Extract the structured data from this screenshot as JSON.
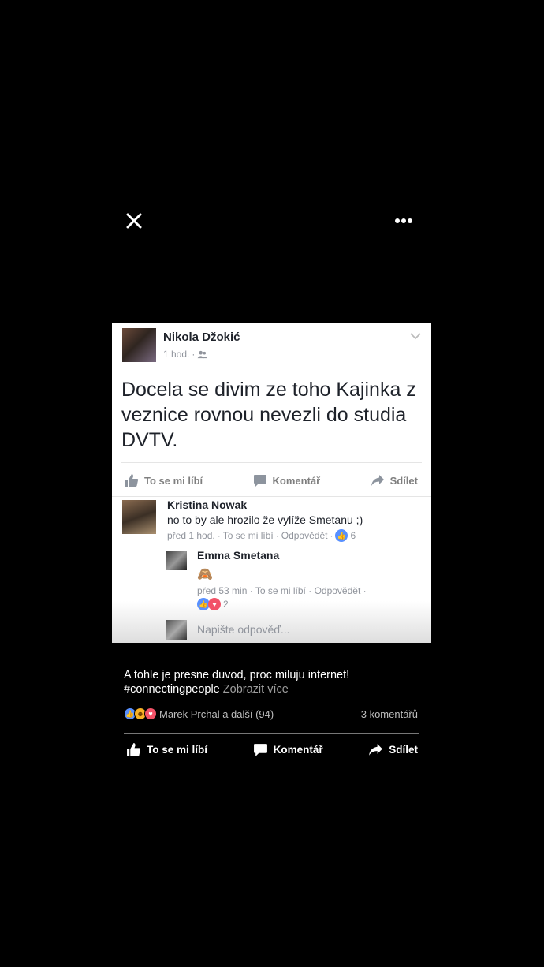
{
  "viewer": {
    "close_icon": "close-icon",
    "more_icon": "more-options-icon"
  },
  "post": {
    "author": "Nikola Džokić",
    "time": "1 hod.",
    "privacy_icon": "friends-icon",
    "text": "Docela se divim ze toho Kajinka z veznice rovnou nevezli do studia DVTV.",
    "actions": {
      "like": "To se mi líbí",
      "comment": "Komentář",
      "share": "Sdílet"
    }
  },
  "comment": {
    "author": "Kristina Nowak",
    "text": "no to by ale hrozilo že vylíže Smetanu ;)",
    "time": "před 1 hod.",
    "like": "To se mi líbí",
    "reply": "Odpovědět",
    "like_count": "6"
  },
  "reply": {
    "author": "Emma Smetana",
    "emoji": "🙈",
    "time": "před 53 min",
    "like": "To se mi líbí",
    "reply": "Odpovědět",
    "reaction_count": "2"
  },
  "write_reply": {
    "placeholder": "Napište odpověď..."
  },
  "caption": {
    "text": "A tohle je presne duvod, proc miluju internet!",
    "hashtag": "#connectingpeople",
    "see_more": "Zobrazit více"
  },
  "footer": {
    "reactions_text": "Marek Prchal a další (94)",
    "comment_count": "3 komentářů",
    "actions": {
      "like": "To se mi líbí",
      "comment": "Komentář",
      "share": "Sdílet"
    }
  },
  "colors": {
    "like": "#5890ff",
    "love": "#f25268",
    "haha": "#f7b125"
  }
}
